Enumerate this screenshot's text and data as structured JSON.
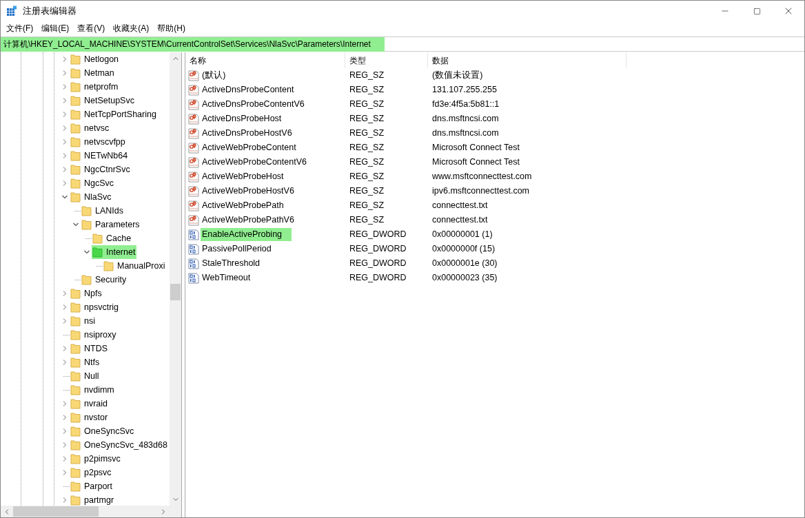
{
  "window": {
    "title": "注册表编辑器"
  },
  "menu": [
    "文件(F)",
    "编辑(E)",
    "查看(V)",
    "收藏夹(A)",
    "帮助(H)"
  ],
  "address": {
    "value": "计算机\\HKEY_LOCAL_MACHINE\\SYSTEM\\CurrentControlSet\\Services\\NlaSvc\\Parameters\\Internet",
    "highlighted": true
  },
  "tree": [
    {
      "label": "Netlogon",
      "expandable": true,
      "expanded": false,
      "selected": false
    },
    {
      "label": "Netman",
      "expandable": true,
      "expanded": false,
      "selected": false
    },
    {
      "label": "netprofm",
      "expandable": true,
      "expanded": false,
      "selected": false
    },
    {
      "label": "NetSetupSvc",
      "expandable": true,
      "expanded": false,
      "selected": false
    },
    {
      "label": "NetTcpPortSharing",
      "expandable": true,
      "expanded": false,
      "selected": false
    },
    {
      "label": "netvsc",
      "expandable": true,
      "expanded": false,
      "selected": false
    },
    {
      "label": "netvscvfpp",
      "expandable": true,
      "expanded": false,
      "selected": false
    },
    {
      "label": "NETwNb64",
      "expandable": true,
      "expanded": false,
      "selected": false
    },
    {
      "label": "NgcCtnrSvc",
      "expandable": true,
      "expanded": false,
      "selected": false
    },
    {
      "label": "NgcSvc",
      "expandable": true,
      "expanded": false,
      "selected": false
    },
    {
      "label": "NlaSvc",
      "expandable": true,
      "expanded": true,
      "selected": false,
      "children": [
        {
          "label": "LANIds",
          "expandable": false,
          "selected": false
        },
        {
          "label": "Parameters",
          "expandable": true,
          "expanded": true,
          "selected": false,
          "children": [
            {
              "label": "Cache",
              "expandable": false,
              "selected": false
            },
            {
              "label": "Internet",
              "expandable": true,
              "expanded": true,
              "selected": true,
              "children": [
                {
                  "label": "ManualProxi",
                  "expandable": false,
                  "selected": false
                }
              ]
            }
          ]
        },
        {
          "label": "Security",
          "expandable": false,
          "selected": false
        }
      ]
    },
    {
      "label": "Npfs",
      "expandable": true,
      "expanded": false,
      "selected": false
    },
    {
      "label": "npsvctrig",
      "expandable": true,
      "expanded": false,
      "selected": false
    },
    {
      "label": "nsi",
      "expandable": true,
      "expanded": false,
      "selected": false
    },
    {
      "label": "nsiproxy",
      "expandable": false,
      "selected": false
    },
    {
      "label": "NTDS",
      "expandable": true,
      "expanded": false,
      "selected": false
    },
    {
      "label": "Ntfs",
      "expandable": true,
      "expanded": false,
      "selected": false
    },
    {
      "label": "Null",
      "expandable": false,
      "selected": false
    },
    {
      "label": "nvdimm",
      "expandable": false,
      "selected": false
    },
    {
      "label": "nvraid",
      "expandable": true,
      "expanded": false,
      "selected": false
    },
    {
      "label": "nvstor",
      "expandable": true,
      "expanded": false,
      "selected": false
    },
    {
      "label": "OneSyncSvc",
      "expandable": true,
      "expanded": false,
      "selected": false
    },
    {
      "label": "OneSyncSvc_483d68",
      "expandable": true,
      "expanded": false,
      "selected": false
    },
    {
      "label": "p2pimsvc",
      "expandable": true,
      "expanded": false,
      "selected": false
    },
    {
      "label": "p2psvc",
      "expandable": true,
      "expanded": false,
      "selected": false
    },
    {
      "label": "Parport",
      "expandable": false,
      "selected": false
    },
    {
      "label": "partmgr",
      "expandable": true,
      "expanded": false,
      "selected": false
    }
  ],
  "table": {
    "columns": [
      "名称",
      "类型",
      "数据"
    ],
    "rows": [
      {
        "kind": "sz",
        "name": "(默认)",
        "type": "REG_SZ",
        "data": "(数值未设置)",
        "selected": false
      },
      {
        "kind": "sz",
        "name": "ActiveDnsProbeContent",
        "type": "REG_SZ",
        "data": "131.107.255.255",
        "selected": false
      },
      {
        "kind": "sz",
        "name": "ActiveDnsProbeContentV6",
        "type": "REG_SZ",
        "data": "fd3e:4f5a:5b81::1",
        "selected": false
      },
      {
        "kind": "sz",
        "name": "ActiveDnsProbeHost",
        "type": "REG_SZ",
        "data": "dns.msftncsi.com",
        "selected": false
      },
      {
        "kind": "sz",
        "name": "ActiveDnsProbeHostV6",
        "type": "REG_SZ",
        "data": "dns.msftncsi.com",
        "selected": false
      },
      {
        "kind": "sz",
        "name": "ActiveWebProbeContent",
        "type": "REG_SZ",
        "data": "Microsoft Connect Test",
        "selected": false
      },
      {
        "kind": "sz",
        "name": "ActiveWebProbeContentV6",
        "type": "REG_SZ",
        "data": "Microsoft Connect Test",
        "selected": false
      },
      {
        "kind": "sz",
        "name": "ActiveWebProbeHost",
        "type": "REG_SZ",
        "data": "www.msftconnecttest.com",
        "selected": false
      },
      {
        "kind": "sz",
        "name": "ActiveWebProbeHostV6",
        "type": "REG_SZ",
        "data": "ipv6.msftconnecttest.com",
        "selected": false
      },
      {
        "kind": "sz",
        "name": "ActiveWebProbePath",
        "type": "REG_SZ",
        "data": "connecttest.txt",
        "selected": false
      },
      {
        "kind": "sz",
        "name": "ActiveWebProbePathV6",
        "type": "REG_SZ",
        "data": "connecttest.txt",
        "selected": false
      },
      {
        "kind": "dword",
        "name": "EnableActiveProbing",
        "type": "REG_DWORD",
        "data": "0x00000001 (1)",
        "selected": true
      },
      {
        "kind": "dword",
        "name": "PassivePollPeriod",
        "type": "REG_DWORD",
        "data": "0x0000000f (15)",
        "selected": false
      },
      {
        "kind": "dword",
        "name": "StaleThreshold",
        "type": "REG_DWORD",
        "data": "0x0000001e (30)",
        "selected": false
      },
      {
        "kind": "dword",
        "name": "WebTimeout",
        "type": "REG_DWORD",
        "data": "0x00000023 (35)",
        "selected": false
      }
    ]
  }
}
